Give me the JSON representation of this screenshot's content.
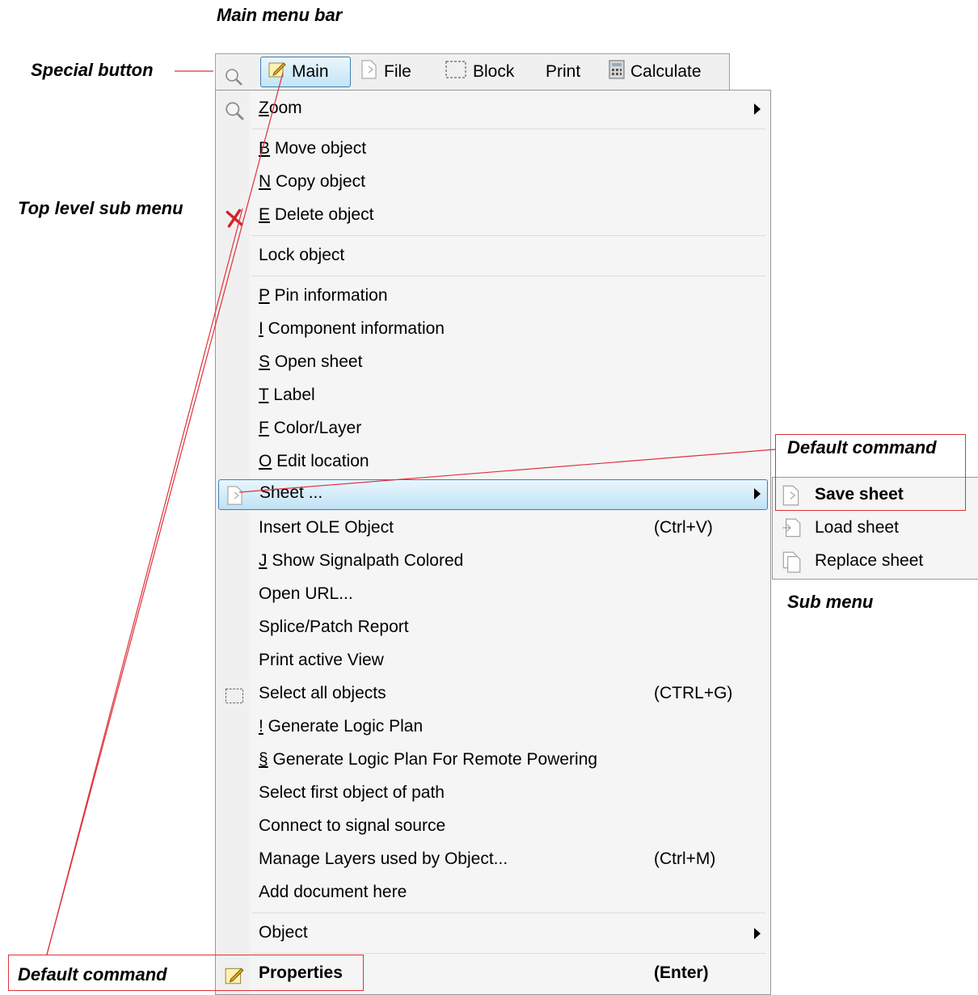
{
  "annotations": {
    "main_menu_bar": "Main menu bar",
    "special_button": "Special button",
    "top_level_sub_menu": "Top level sub menu",
    "default_command_right": "Default command",
    "sub_menu": "Sub menu",
    "default_command_bottom": "Default command"
  },
  "menubar": {
    "main": "Main",
    "file": "File",
    "block": "Block",
    "print": "Print",
    "calculate": "Calculate"
  },
  "menu": {
    "zoom": {
      "key": "Z",
      "rest": "oom"
    },
    "move": {
      "key": "B",
      "rest": " Move object"
    },
    "copy": {
      "key": "N",
      "rest": " Copy object"
    },
    "delete": {
      "key": "E",
      "rest": " Delete object"
    },
    "lock": "Lock object",
    "pin": {
      "key": "P",
      "rest": " Pin information"
    },
    "component": {
      "key": "I",
      "rest": " Component information"
    },
    "open_sheet": {
      "key": "S",
      "rest": " Open sheet"
    },
    "label": {
      "key": "T",
      "rest": " Label"
    },
    "color_layer": {
      "key": "F",
      "rest": " Color/Layer"
    },
    "edit_location": {
      "key": "O",
      "rest": " Edit location"
    },
    "sheet": "Sheet ...",
    "insert_ole": "Insert OLE Object",
    "insert_ole_sc": "(Ctrl+V)",
    "signalpath": {
      "key": "J",
      "rest": " Show Signalpath Colored"
    },
    "open_url": "Open URL...",
    "splice": "Splice/Patch Report",
    "print_view": "Print active View",
    "select_all": "Select all objects",
    "select_all_sc": "(CTRL+G)",
    "gen_logic": {
      "key": "!",
      "rest": " Generate Logic Plan"
    },
    "gen_logic_remote": {
      "key": "§",
      "rest": " Generate Logic Plan For Remote Powering"
    },
    "select_first": "Select first object of path",
    "connect": "Connect to signal source",
    "manage_layers": "Manage Layers used by Object...",
    "manage_layers_sc": "(Ctrl+M)",
    "add_document": "Add document here",
    "object": "Object",
    "properties": "Properties",
    "properties_sc": "(Enter)"
  },
  "submenu": {
    "save": "Save sheet",
    "load": "Load sheet",
    "replace": "Replace sheet"
  },
  "colors": {
    "highlight_border": "#3c7fb1",
    "annotation_red": "#e0303a"
  }
}
